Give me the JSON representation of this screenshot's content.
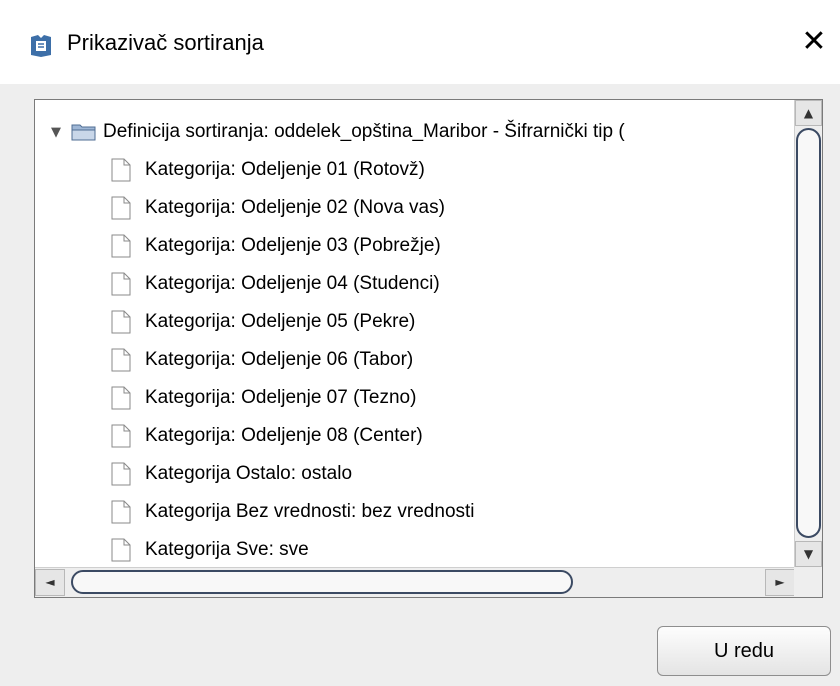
{
  "window": {
    "title": "Prikazivač sortiranja",
    "close_glyph": "✕",
    "app_icon": "document-sort-icon"
  },
  "tree": {
    "root": {
      "label": "Definicija sortiranja: oddelek_opština_Maribor - Šifrarnički tip (",
      "expanded": true,
      "toggle_glyph": "▼",
      "icon": "folder-icon"
    },
    "children": [
      {
        "label": "Kategorija: Odeljenje 01 (Rotovž)",
        "icon": "file-icon"
      },
      {
        "label": "Kategorija: Odeljenje 02 (Nova vas)",
        "icon": "file-icon"
      },
      {
        "label": "Kategorija: Odeljenje 03 (Pobrežje)",
        "icon": "file-icon"
      },
      {
        "label": "Kategorija: Odeljenje 04 (Studenci)",
        "icon": "file-icon"
      },
      {
        "label": "Kategorija: Odeljenje 05 (Pekre)",
        "icon": "file-icon"
      },
      {
        "label": "Kategorija: Odeljenje 06 (Tabor)",
        "icon": "file-icon"
      },
      {
        "label": "Kategorija: Odeljenje 07 (Tezno)",
        "icon": "file-icon"
      },
      {
        "label": "Kategorija: Odeljenje 08 (Center)",
        "icon": "file-icon"
      },
      {
        "label": "Kategorija Ostalo: ostalo",
        "icon": "file-icon"
      },
      {
        "label": "Kategorija Bez vrednosti: bez vrednosti",
        "icon": "file-icon"
      },
      {
        "label": "Kategorija Sve: sve",
        "icon": "file-icon"
      }
    ]
  },
  "scrollbars": {
    "up_glyph": "▲",
    "down_glyph": "▼",
    "left_glyph": "◄",
    "right_glyph": "►"
  },
  "buttons": {
    "ok_label": "U redu"
  },
  "colors": {
    "dialog_background": "#eeeeee",
    "thumb_border": "#3b4a63"
  }
}
